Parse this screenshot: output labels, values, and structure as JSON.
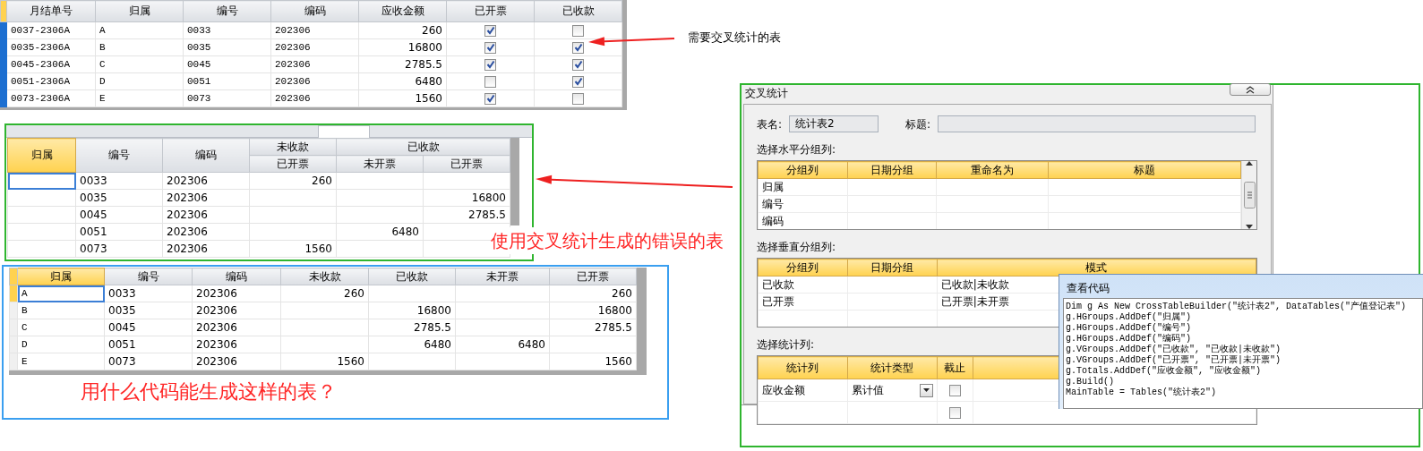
{
  "source_table": {
    "columns": [
      {
        "label": "月结单号",
        "kind": "text"
      },
      {
        "label": "归属",
        "kind": "text"
      },
      {
        "label": "编号",
        "kind": "text"
      },
      {
        "label": "编码",
        "kind": "text"
      },
      {
        "label": "应收金额",
        "kind": "number"
      },
      {
        "label": "已开票",
        "kind": "check"
      },
      {
        "label": "已收款",
        "kind": "check"
      }
    ],
    "rows": [
      {
        "cells": [
          "0037-2306A",
          "A",
          "0033",
          "202306",
          "260",
          {
            "checked": true
          },
          {
            "checked": false
          }
        ]
      },
      {
        "cells": [
          "0035-2306A",
          "B",
          "0035",
          "202306",
          "16800",
          {
            "checked": true
          },
          {
            "checked": true
          }
        ]
      },
      {
        "cells": [
          "0045-2306A",
          "C",
          "0045",
          "202306",
          "2785.5",
          {
            "checked": true
          },
          {
            "checked": true
          }
        ]
      },
      {
        "cells": [
          "0051-2306A",
          "D",
          "0051",
          "202306",
          "6480",
          {
            "checked": false
          },
          {
            "checked": true
          }
        ]
      },
      {
        "cells": [
          "0073-2306A",
          "E",
          "0073",
          "202306",
          "1560",
          {
            "checked": true
          },
          {
            "checked": false
          }
        ]
      }
    ]
  },
  "source_note": "需要交叉统计的表",
  "wrong_table": {
    "columns": [
      {
        "label": "归属",
        "selected": true
      },
      {
        "label": "编号",
        "selected": false
      },
      {
        "label": "编码",
        "selected": false
      }
    ],
    "groups": [
      {
        "label": "未收款",
        "subcolumns": [
          "已开票"
        ]
      },
      {
        "label": "已收款",
        "subcolumns": [
          "未开票",
          "已开票"
        ]
      }
    ],
    "rows": [
      [
        null,
        "0033",
        "202306",
        "260",
        null,
        null
      ],
      [
        null,
        "0035",
        "202306",
        null,
        null,
        "16800"
      ],
      [
        null,
        "0045",
        "202306",
        null,
        null,
        "2785.5"
      ],
      [
        null,
        "0051",
        "202306",
        null,
        "6480",
        null
      ],
      [
        null,
        "0073",
        "202306",
        "1560",
        null,
        null
      ]
    ]
  },
  "wrong_note": "使用交叉统计生成的错误的表",
  "wanted_table": {
    "columns": [
      {
        "label": "归属",
        "kind": "text",
        "selected": true
      },
      {
        "label": "编号",
        "kind": "text",
        "selected": false
      },
      {
        "label": "编码",
        "kind": "text",
        "selected": false
      },
      {
        "label": "未收款",
        "kind": "number",
        "selected": false
      },
      {
        "label": "已收款",
        "kind": "number",
        "selected": false
      },
      {
        "label": "未开票",
        "kind": "number",
        "selected": false
      },
      {
        "label": "已开票",
        "kind": "number",
        "selected": false
      }
    ],
    "rows": [
      [
        "A",
        "0033",
        "202306",
        "260",
        null,
        null,
        "260"
      ],
      [
        "B",
        "0035",
        "202306",
        null,
        "16800",
        null,
        "16800"
      ],
      [
        "C",
        "0045",
        "202306",
        null,
        "2785.5",
        null,
        "2785.5"
      ],
      [
        "D",
        "0051",
        "202306",
        null,
        "6480",
        "6480",
        null
      ],
      [
        "E",
        "0073",
        "202306",
        "1560",
        null,
        null,
        "1560"
      ]
    ]
  },
  "wanted_note": "用什么代码能生成这样的表？",
  "dialog": {
    "title": "交叉统计",
    "table_name": {
      "label": "表名:",
      "value": "统计表2"
    },
    "caption": {
      "label": "标题:"
    },
    "horizontal": {
      "label": "选择水平分组列:",
      "columns": [
        "分组列",
        "日期分组",
        "重命名为",
        "标题"
      ],
      "rows": [
        "归属",
        "编号",
        "编码"
      ]
    },
    "vertical": {
      "label": "选择垂直分组列:",
      "columns": [
        "分组列",
        "日期分组",
        "模式"
      ],
      "rows": [
        {
          "column": "已收款",
          "mode": "已收款|未收款"
        },
        {
          "column": "已开票",
          "mode": "已开票|未开票"
        }
      ]
    },
    "totals": {
      "label": "选择统计列:",
      "columns": [
        "统计列",
        "统计类型",
        "截止"
      ],
      "rows": [
        {
          "field": "应收金额",
          "type": "累计值",
          "cutoff": false
        },
        {
          "cutoff": false
        }
      ]
    }
  },
  "code_window": {
    "title": "查看代码",
    "lines": [
      "Dim g As New CrossTableBuilder(\"统计表2\", DataTables(\"产值登记表\")",
      "g.HGroups.AddDef(\"归属\")",
      "g.HGroups.AddDef(\"编号\")",
      "g.HGroups.AddDef(\"编码\")",
      "g.VGroups.AddDef(\"已收款\", \"已收款|未收款\")",
      "g.VGroups.AddDef(\"已开票\", \"已开票|未开票\")",
      "g.Totals.AddDef(\"应收金额\", \"应收金额\")",
      "g.Build()",
      "MainTable = Tables(\"统计表2\")"
    ]
  }
}
